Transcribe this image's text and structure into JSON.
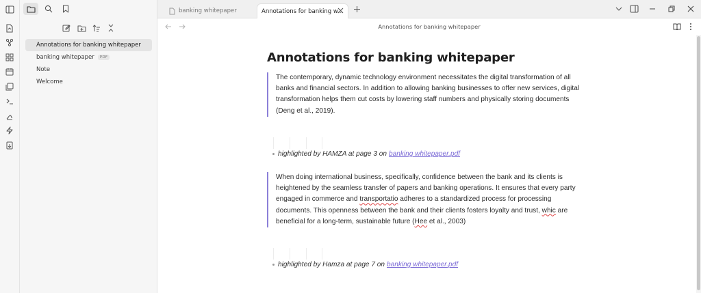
{
  "tabs": [
    {
      "label": "banking whitepaper",
      "active": false
    },
    {
      "label": "Annotations for banking w...",
      "active": true
    }
  ],
  "sidebar": {
    "files": [
      {
        "label": "Annotations for banking whitepaper",
        "active": true
      },
      {
        "label": "banking whitepaper",
        "badge": "PDF"
      },
      {
        "label": "Note"
      },
      {
        "label": "Welcome"
      }
    ]
  },
  "view": {
    "title": "Annotations for banking whitepaper"
  },
  "document": {
    "heading": "Annotations for banking whitepaper",
    "annotation1": {
      "quote": "The contemporary, dynamic technology environment necessitates the digital transformation of all banks and financial sectors. In addition to allowing banking businesses to offer new services, digital transformation helps them cut costs by lowering staff numbers and physically storing documents (Deng et al., 2019).",
      "meta": "highlighted by HAMZA at page 3 on",
      "link": "banking whitepaper.pdf"
    },
    "annotation2": {
      "q1": "When doing international business, specifically, confidence between the bank and its clients is heightened by the seamless transfer of papers and banking operations. It ensures that every party engaged in commerce and ",
      "q2": "transportatio",
      "q3": " adheres to a standardized process for processing documents. This openness between the bank and their clients fosters loyalty and trust, ",
      "q4": "whic",
      "q5": " are beneficial for a long-term, sustainable future (",
      "q6": "Hee",
      "q7": " et al., 2003)",
      "meta": "highlighted by Hamza at page 7 on",
      "link": "banking whitepaper.pdf"
    }
  },
  "colors": {
    "accent": "#7b6ad6",
    "quote_border": "#8b7fd8",
    "spellcheck": "#e04545"
  }
}
